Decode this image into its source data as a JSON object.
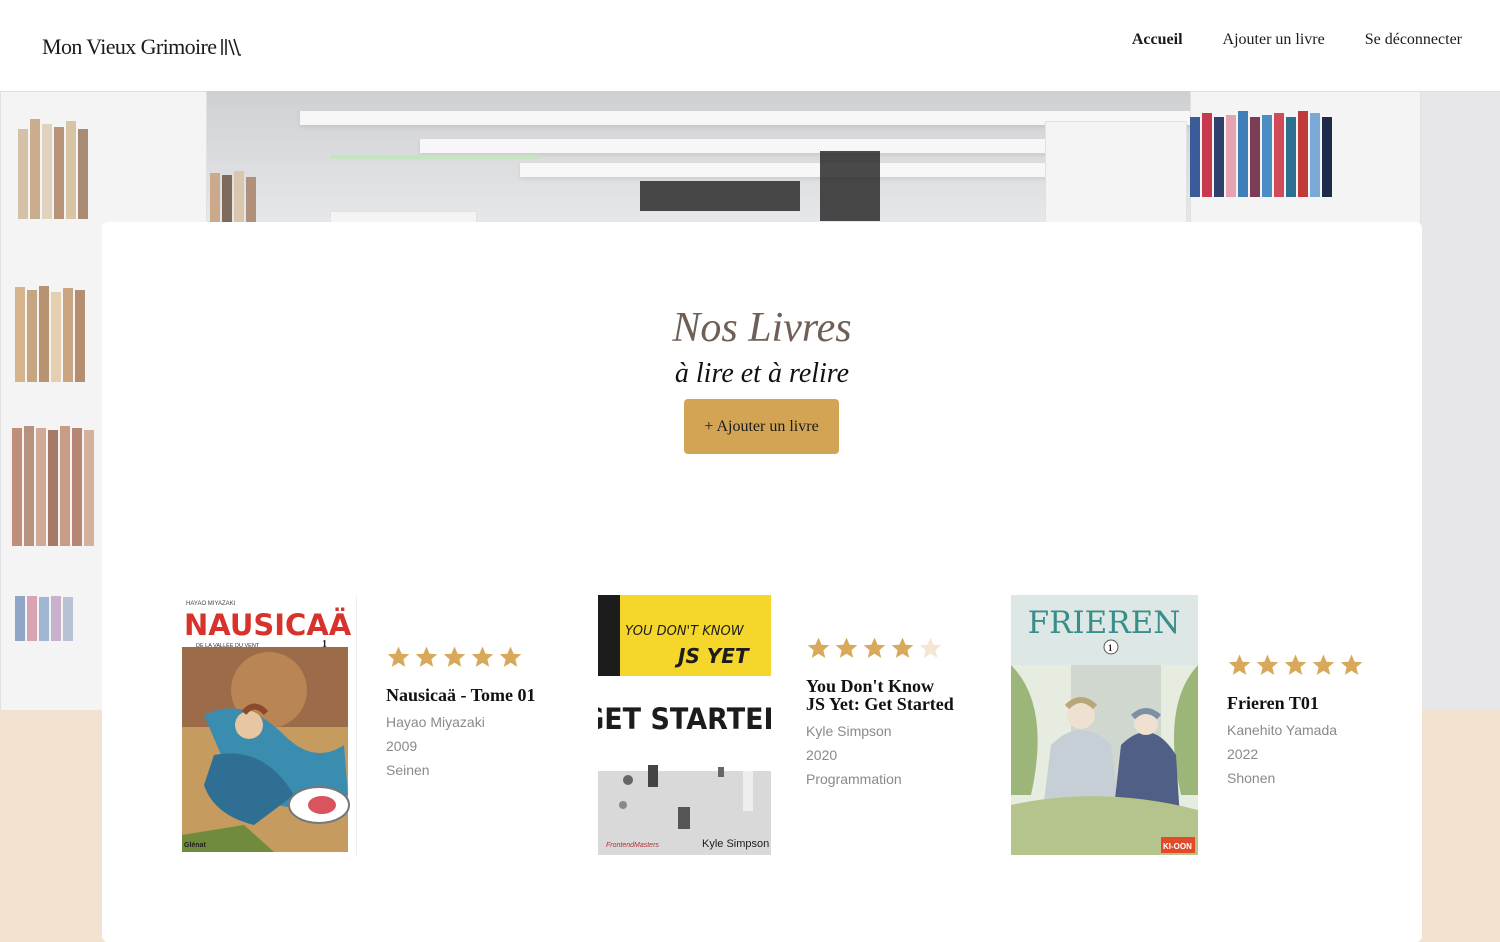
{
  "header": {
    "brand": "Mon Vieux Grimoire",
    "nav": [
      {
        "label": "Accueil",
        "active": true
      },
      {
        "label": "Ajouter un livre",
        "active": false
      },
      {
        "label": "Se déconnecter",
        "active": false
      }
    ]
  },
  "main": {
    "title": "Nos Livres",
    "subtitle": "à lire et à relire",
    "add_button": "+ Ajouter un livre"
  },
  "books": [
    {
      "title": "Nausicaä - Tome 01",
      "author": "Hayao Miyazaki",
      "year": "2009",
      "genre": "Seinen",
      "rating": 5,
      "cover_text": {
        "top": "HAYAO MIYAZAKI",
        "main": "NAUSICAÄ",
        "sub": "DE LA VALLÉE DU VENT",
        "num": "1",
        "publisher": "Glénat"
      }
    },
    {
      "title": "You Don't Know JS Yet: Get Started",
      "author": "Kyle Simpson",
      "year": "2020",
      "genre": "Programmation",
      "rating": 4,
      "cover_text": {
        "line1": "YOU DON'T KNOW",
        "line2": "JS YET",
        "main": "GET STARTED",
        "author": "Kyle Simpson",
        "publisher": "FrontendMasters"
      }
    },
    {
      "title": "Frieren T01",
      "author": "Kanehito Yamada",
      "year": "2022",
      "genre": "Shonen",
      "rating": 5,
      "cover_text": {
        "main": "FRIEREN",
        "num": "1",
        "publisher": "KI-OON"
      }
    }
  ],
  "colors": {
    "accent": "#d2a454",
    "star_filled": "#d8a95a",
    "star_empty": "#f4e6d1",
    "title": "#6f5f55",
    "footer_bg": "#f2e3d1"
  },
  "icons": {
    "logo": "books-icon",
    "star": "star-icon"
  }
}
